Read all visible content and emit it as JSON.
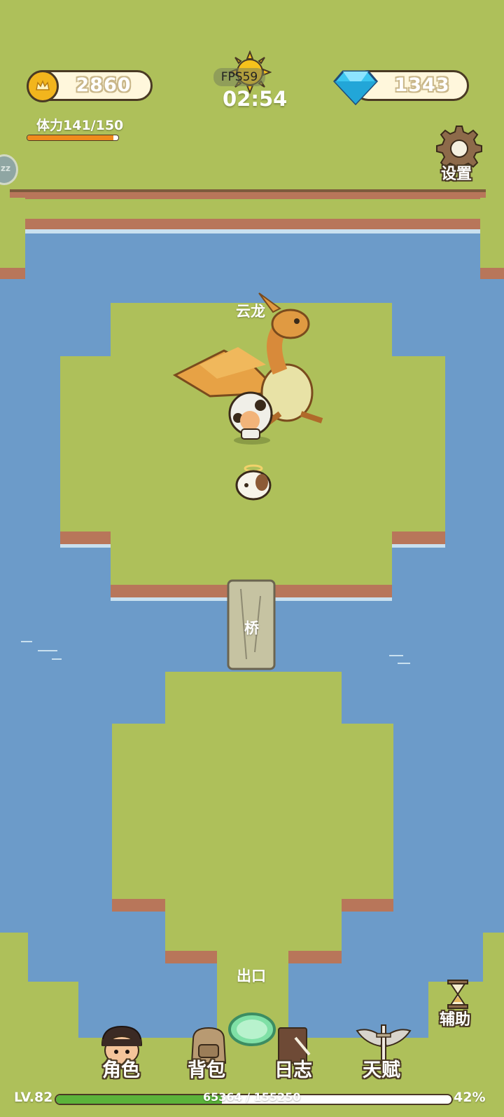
{
  "hud": {
    "gold": "2860",
    "diamonds": "1343",
    "fps": "FPS59",
    "timer": "02:54",
    "stamina_label": "体力141/150",
    "stamina_fraction": 0.947,
    "settings_label": "设置",
    "sleep_label": "zz"
  },
  "map": {
    "dragon_label": "云龙",
    "bridge_label": "桥",
    "exit_label": "出口"
  },
  "side": {
    "assist_label": "辅助"
  },
  "nav": {
    "role": "角色",
    "bag": "背包",
    "log": "日志",
    "talent": "天赋"
  },
  "level": {
    "label": "LV.82",
    "xp": "65364 / 155250",
    "percent": "42%",
    "fraction": 0.42
  },
  "colors": {
    "water": "#6c9bc9",
    "grass": "#aec05a",
    "dirt": "#b8765a",
    "gold": "#f2b51d",
    "diamond": "#3cc6f0",
    "stamina": "#f08b1c",
    "xp": "#5bb33a"
  }
}
